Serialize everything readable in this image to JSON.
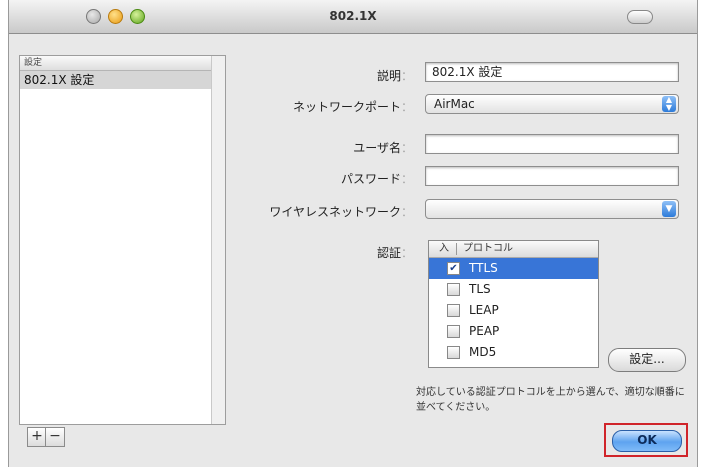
{
  "window": {
    "title": "802.1X"
  },
  "sidebar": {
    "header": "設定",
    "items": [
      {
        "label": "802.1X 設定"
      }
    ],
    "add_label": "+",
    "remove_label": "−"
  },
  "form": {
    "description": {
      "label": "説明",
      "value": "802.1X 設定"
    },
    "network_port": {
      "label": "ネットワークポート",
      "value": "AirMac"
    },
    "username": {
      "label": "ユーザ名",
      "value": ""
    },
    "password": {
      "label": "パスワード",
      "value": ""
    },
    "wireless_network": {
      "label": "ワイヤレスネットワーク",
      "value": ""
    },
    "auth": {
      "label": "認証"
    }
  },
  "protocols": {
    "col_enabled": "入",
    "col_protocol": "プロトコル",
    "rows": [
      {
        "name": "TTLS",
        "checked": true,
        "selected": true
      },
      {
        "name": "TLS",
        "checked": false,
        "selected": false
      },
      {
        "name": "LEAP",
        "checked": false,
        "selected": false
      },
      {
        "name": "PEAP",
        "checked": false,
        "selected": false
      },
      {
        "name": "MD5",
        "checked": false,
        "selected": false
      }
    ]
  },
  "buttons": {
    "configure": "設定...",
    "ok": "OK"
  },
  "note": "対応している認証プロトコルを上から選んで、適切な順番に並べてください。",
  "colors": {
    "selection": "#3875d7",
    "ok_highlight": "#d0242a"
  },
  "icons": {
    "popup_arrow": "updown-arrows-icon",
    "dropdown_arrow": "chevron-down-icon",
    "checkbox": "check-icon"
  }
}
